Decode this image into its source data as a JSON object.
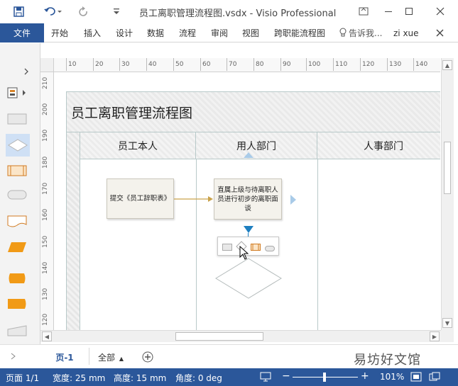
{
  "titlebar": {
    "title": "员工离职管理流程图.vsdx - Visio Professional",
    "save_icon": "save-icon",
    "undo_icon": "undo-icon",
    "redo_icon": "redo-icon",
    "minimize": "—",
    "restore": "❐",
    "close": "✕",
    "help": "?",
    "ribbon_display": "⧉"
  },
  "ribbon": {
    "file": "文件",
    "tabs": [
      "开始",
      "插入",
      "设计",
      "数据",
      "流程",
      "审阅",
      "视图",
      "跨职能流程图"
    ],
    "tell_me": "告诉我...",
    "user": "zi xue",
    "close_ribbon": "✕"
  },
  "ruler": {
    "h_ticks": [
      "10",
      "20",
      "30",
      "40",
      "50",
      "60",
      "70",
      "80",
      "90",
      "100",
      "110",
      "120",
      "130",
      "140"
    ],
    "v_ticks": [
      "210",
      "200",
      "190",
      "180",
      "170",
      "160",
      "150",
      "140",
      "130",
      "120"
    ]
  },
  "diagram": {
    "title": "员工离职管理流程图",
    "lanes": [
      "员工本人",
      "用人部门",
      "人事部门"
    ],
    "process1": "提交《员工辞职表》",
    "process2": "直属上级与待离职人员进行初步的离职面谈"
  },
  "pagebar": {
    "page_tab": "页-1",
    "all_pages": "全部",
    "add_page": "+"
  },
  "status": {
    "page": "页面 1/1",
    "width": "宽度: 25 mm",
    "height": "高度: 15 mm",
    "angle": "角度: 0 deg",
    "zoom": "101%"
  },
  "watermark": "易坊好文馆",
  "colors": {
    "accent": "#2b579a",
    "flow_arrow": "#c9a24a",
    "autoconnect": "#1e7fc0"
  }
}
